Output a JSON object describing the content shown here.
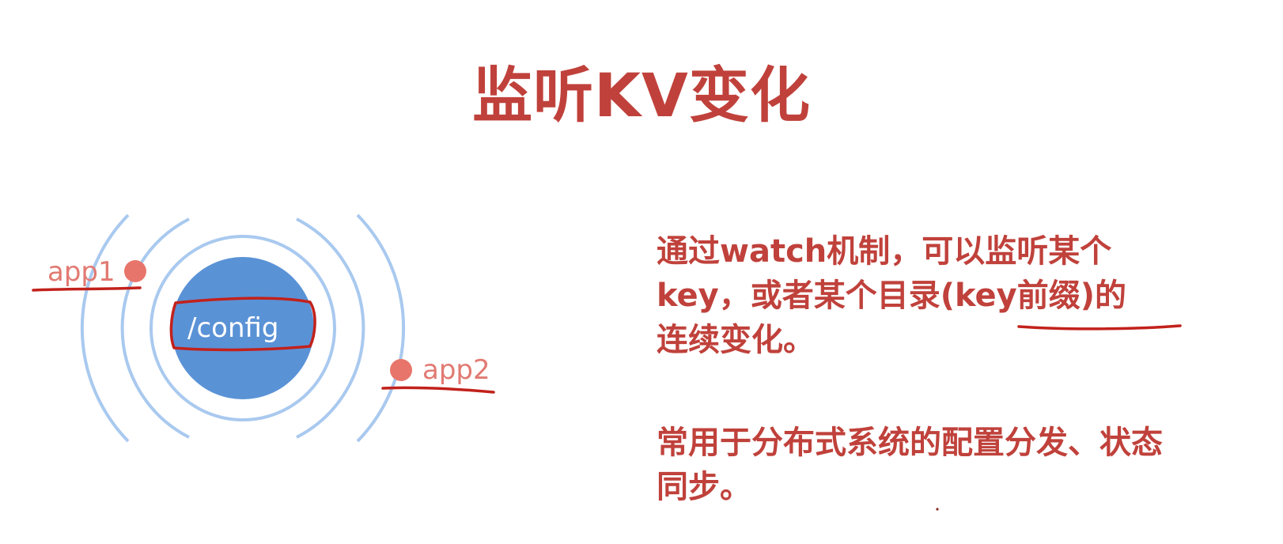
{
  "title": "监听KV变化",
  "diagram": {
    "center_label": "/config",
    "apps": [
      {
        "label": "app1"
      },
      {
        "label": "app2"
      }
    ]
  },
  "description": {
    "paragraph1": "通过watch机制，可以监听某个key，或者某个目录(key前缀)的连续变化。",
    "paragraph1_lines": [
      "通过watch机制，可以监听某个",
      "key，或者某个目录(key前缀)的",
      "连续变化。"
    ],
    "paragraph2_lines": [
      "常用于分布式系统的配置分发、状态",
      "同步。"
    ]
  },
  "colors": {
    "title": "#c0413b",
    "node_fill": "#5a92d6",
    "ring_stroke": "#a9c9ef",
    "app_dot": "#e8756b",
    "app_label": "#e17a72",
    "annotation": "#c2211b"
  }
}
